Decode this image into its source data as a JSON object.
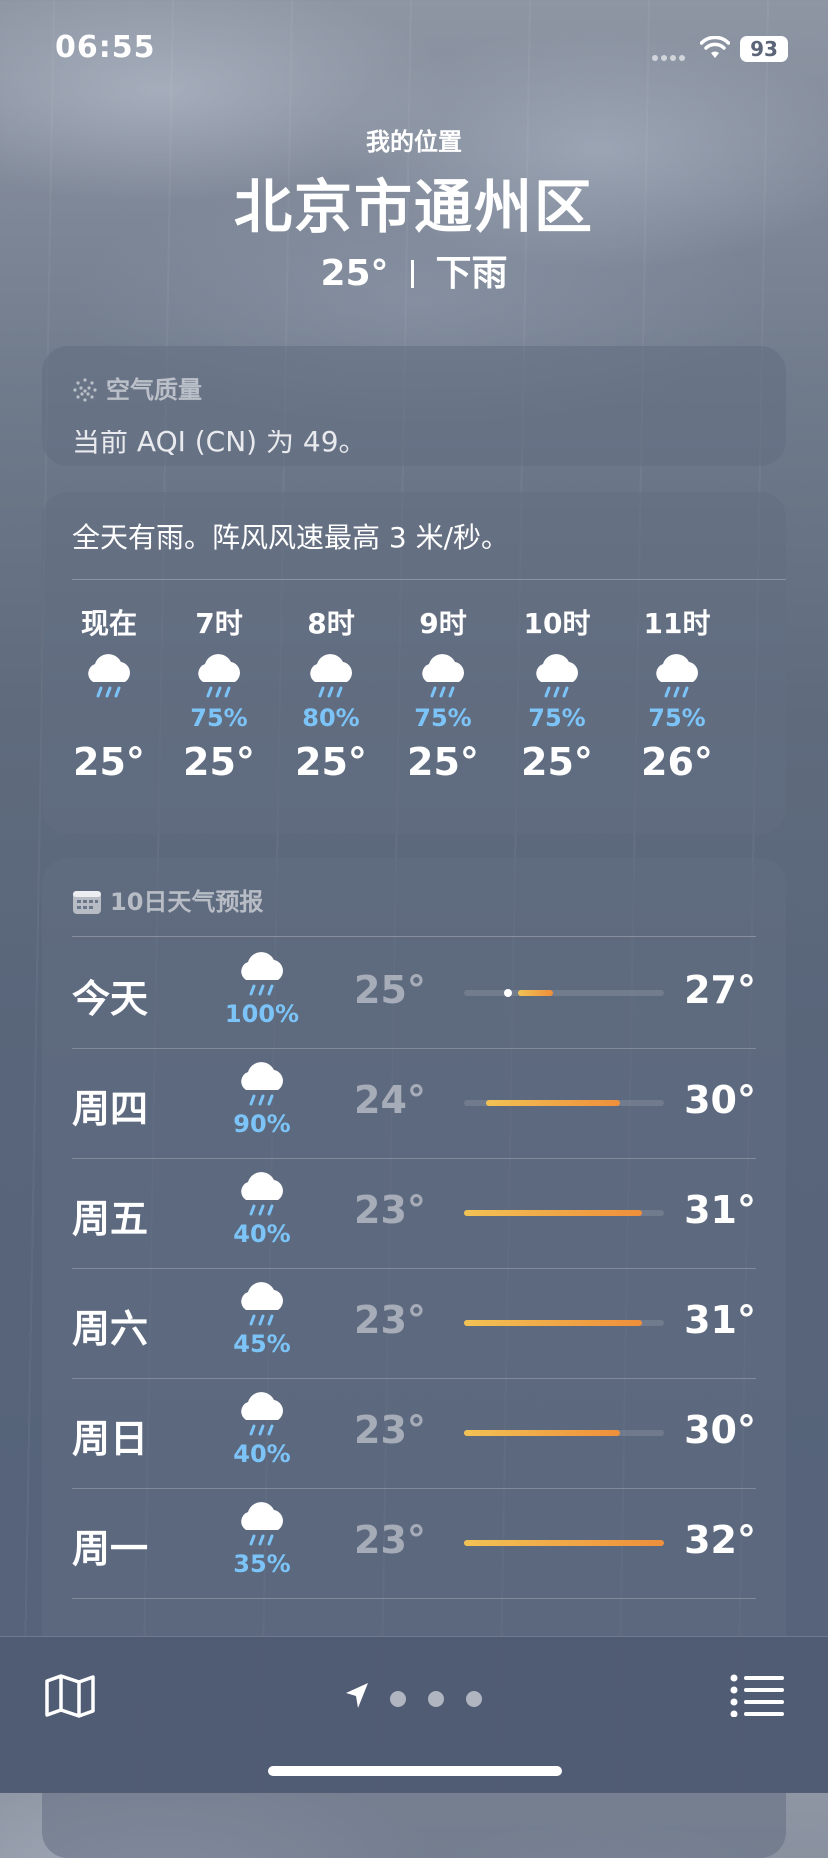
{
  "status_bar": {
    "time": "06:55",
    "battery": "93",
    "icons": [
      "signal-icon",
      "wifi-icon",
      "battery-icon"
    ]
  },
  "header": {
    "location_label": "我的位置",
    "city": "北京市通州区",
    "temperature": "25°",
    "condition": "下雨"
  },
  "air_quality": {
    "title": "空气质量",
    "icon": "air-quality-icon",
    "text": "当前 AQI (CN) 为 49。"
  },
  "hourly": {
    "summary": "全天有雨。阵风风速最高 3 米/秒。",
    "items": [
      {
        "label": "现在",
        "icon": "rain-cloud-icon",
        "precip": "",
        "temp": "25°"
      },
      {
        "label": "7时",
        "icon": "rain-cloud-icon",
        "precip": "75%",
        "temp": "25°"
      },
      {
        "label": "8时",
        "icon": "rain-cloud-icon",
        "precip": "80%",
        "temp": "25°"
      },
      {
        "label": "9时",
        "icon": "rain-cloud-icon",
        "precip": "75%",
        "temp": "25°"
      },
      {
        "label": "10时",
        "icon": "rain-cloud-icon",
        "precip": "75%",
        "temp": "25°"
      },
      {
        "label": "11时",
        "icon": "rain-cloud-icon",
        "precip": "75%",
        "temp": "26°"
      }
    ]
  },
  "forecast": {
    "title": "10日天气预报",
    "icon": "calendar-icon",
    "range_bar_scale": {
      "min": 23,
      "max": 32
    },
    "days": [
      {
        "day": "今天",
        "icon": "rain-cloud-icon",
        "precip": "100%",
        "low": "25°",
        "high": "27°",
        "low_value": 25,
        "high_value": 27,
        "current_value": 25,
        "is_today": true
      },
      {
        "day": "周四",
        "icon": "rain-cloud-icon",
        "precip": "90%",
        "low": "24°",
        "high": "30°",
        "low_value": 24,
        "high_value": 30
      },
      {
        "day": "周五",
        "icon": "rain-cloud-icon",
        "precip": "40%",
        "low": "23°",
        "high": "31°",
        "low_value": 23,
        "high_value": 31
      },
      {
        "day": "周六",
        "icon": "rain-cloud-icon",
        "precip": "45%",
        "low": "23°",
        "high": "31°",
        "low_value": 23,
        "high_value": 31
      },
      {
        "day": "周日",
        "icon": "rain-cloud-icon",
        "precip": "40%",
        "low": "23°",
        "high": "30°",
        "low_value": 23,
        "high_value": 30
      },
      {
        "day": "周一",
        "icon": "rain-cloud-icon",
        "precip": "35%",
        "low": "23°",
        "high": "32°",
        "low_value": 23,
        "high_value": 32
      }
    ]
  },
  "bottom_bar": {
    "left_icon": "map-icon",
    "right_icon": "list-icon",
    "page_indicator": {
      "pages": 4,
      "current": 0,
      "current_icon": "location-arrow-icon"
    }
  }
}
